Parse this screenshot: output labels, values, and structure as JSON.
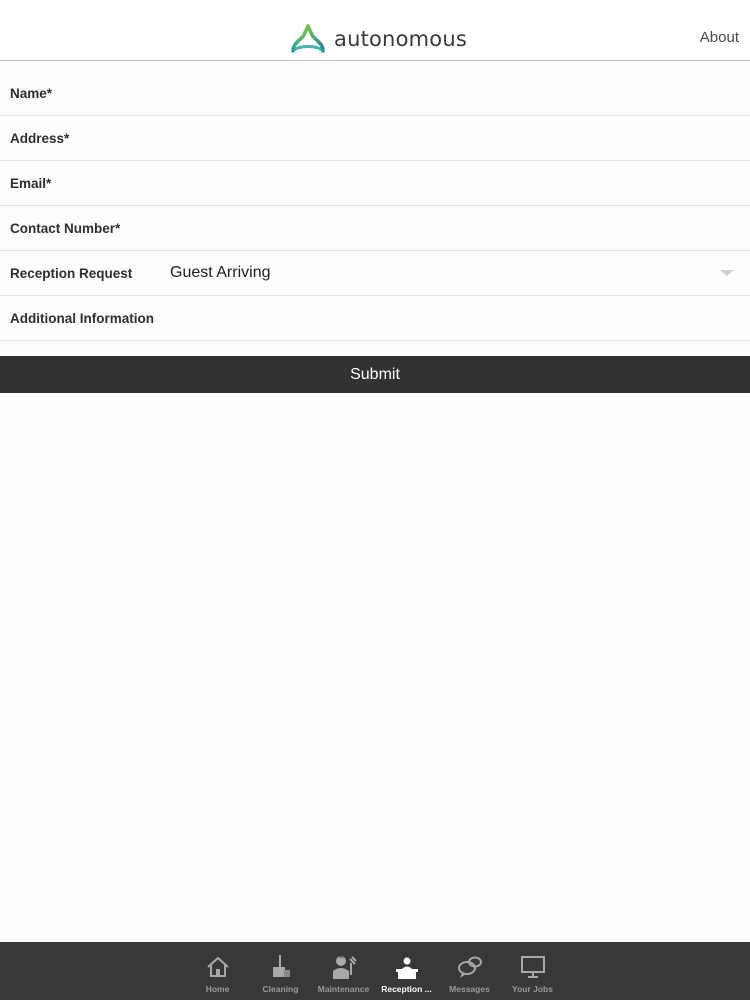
{
  "header": {
    "brand_name": "autonomous",
    "about_label": "About",
    "brand_colors": {
      "teal": "#2aa6a0",
      "green": "#7dc242",
      "blue": "#1c7fb6"
    }
  },
  "form": {
    "fields": [
      {
        "label": "Name*",
        "value": ""
      },
      {
        "label": "Address*",
        "value": ""
      },
      {
        "label": "Email*",
        "value": ""
      },
      {
        "label": "Contact Number*",
        "value": ""
      }
    ],
    "reception_request": {
      "label": "Reception Request",
      "selected": "Guest Arriving"
    },
    "additional_info": {
      "label": "Additional Information",
      "value": ""
    },
    "submit_label": "Submit"
  },
  "tabbar": {
    "tabs": [
      {
        "label": "Home",
        "icon": "home-icon",
        "active": false
      },
      {
        "label": "Cleaning",
        "icon": "cleaning-icon",
        "active": false
      },
      {
        "label": "Maintenance",
        "icon": "maintenance-icon",
        "active": false
      },
      {
        "label": "Reception ...",
        "icon": "reception-icon",
        "active": true
      },
      {
        "label": "Messages",
        "icon": "messages-icon",
        "active": false
      },
      {
        "label": "Your Jobs",
        "icon": "monitor-icon",
        "active": false
      }
    ]
  }
}
